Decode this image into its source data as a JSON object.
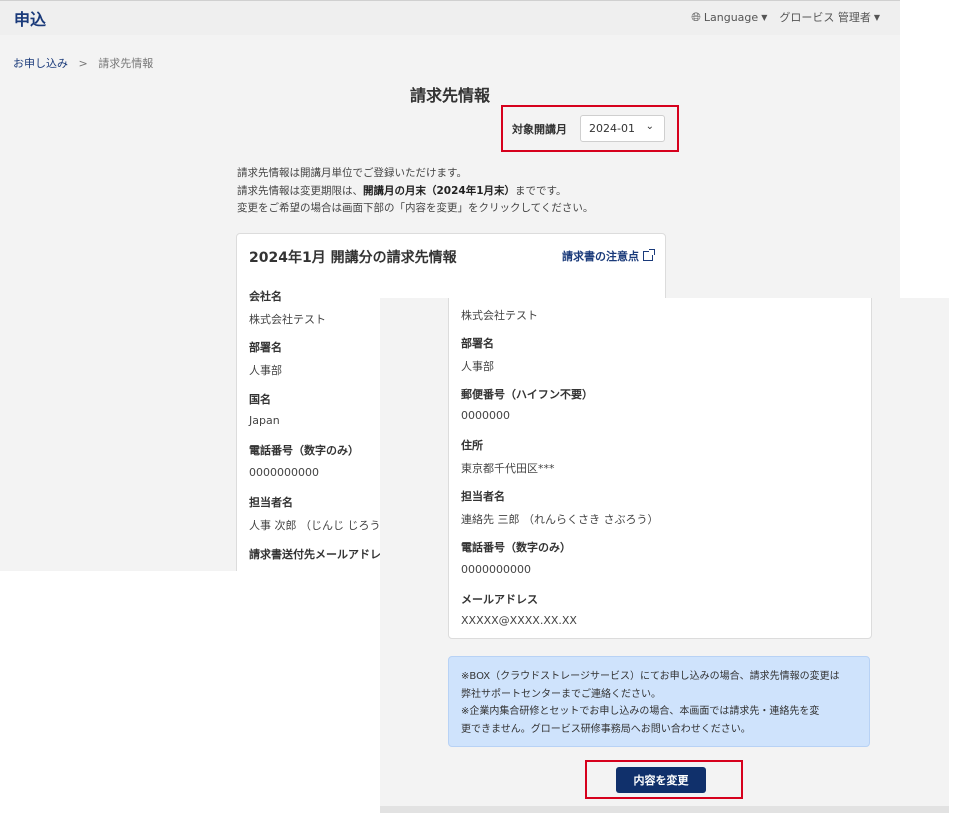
{
  "header": {
    "app_title": "申込",
    "language_label": "Language",
    "user_label": "グロービス 管理者"
  },
  "breadcrumb": {
    "home": "お申し込み",
    "separator": ">",
    "current": "請求先情報"
  },
  "page": {
    "title": "請求先情報",
    "period_label": "対象開講月",
    "period_value": "2024-01",
    "intro": {
      "line1": "請求先情報は開講月単位でご登録いただけます。",
      "line2_pre": "請求先情報は変更期限は、",
      "line2_bold": "開講月の月末（2024年1月末）",
      "line2_post": "までです。",
      "line3": "変更をご希望の場合は画面下部の「内容を変更」をクリックしてください。"
    }
  },
  "card1": {
    "title": "2024年1月 開講分の請求先情報",
    "notes_link": "請求書の注意点",
    "fields": [
      {
        "label": "会社名",
        "value": "株式会社テスト"
      },
      {
        "label": "部署名",
        "value": "人事部"
      },
      {
        "label": "国名",
        "value": "Japan"
      },
      {
        "label": "電話番号（数字のみ）",
        "value": "0000000000"
      },
      {
        "label": "担当者名",
        "value": "人事 次郎 （じんじ じろう）"
      },
      {
        "label": "請求書送付先メールアドレス",
        "value": ""
      }
    ]
  },
  "card2": {
    "first_value": "株式会社テスト",
    "fields": [
      {
        "label": "部署名",
        "value": "人事部"
      },
      {
        "label": "郵便番号（ハイフン不要）",
        "value": "0000000"
      },
      {
        "label": "住所",
        "value": "東京都千代田区***"
      },
      {
        "label": "担当者名",
        "value": "連絡先 三郎 （れんらくさき さぶろう）"
      },
      {
        "label": "電話番号（数字のみ）",
        "value": "0000000000"
      },
      {
        "label": "メールアドレス",
        "value": "XXXXX@XXXX.XX.XX"
      }
    ]
  },
  "notice": {
    "line1": "※BOX（クラウドストレージサービス）にてお申し込みの場合、請求先情報の変更は",
    "line2": "弊社サポートセンターまでご連絡ください。",
    "line3": "※企業内集合研修とセットでお申し込みの場合、本画面では請求先・連絡先を変",
    "line4": "更できません。グロービス研修事務局へお問い合わせください。"
  },
  "change_button_label": "内容を変更",
  "colors": {
    "accent": "#1a3a7a",
    "button": "#10306b",
    "highlight": "#d6001c",
    "notice_bg": "#cfe3fc"
  }
}
